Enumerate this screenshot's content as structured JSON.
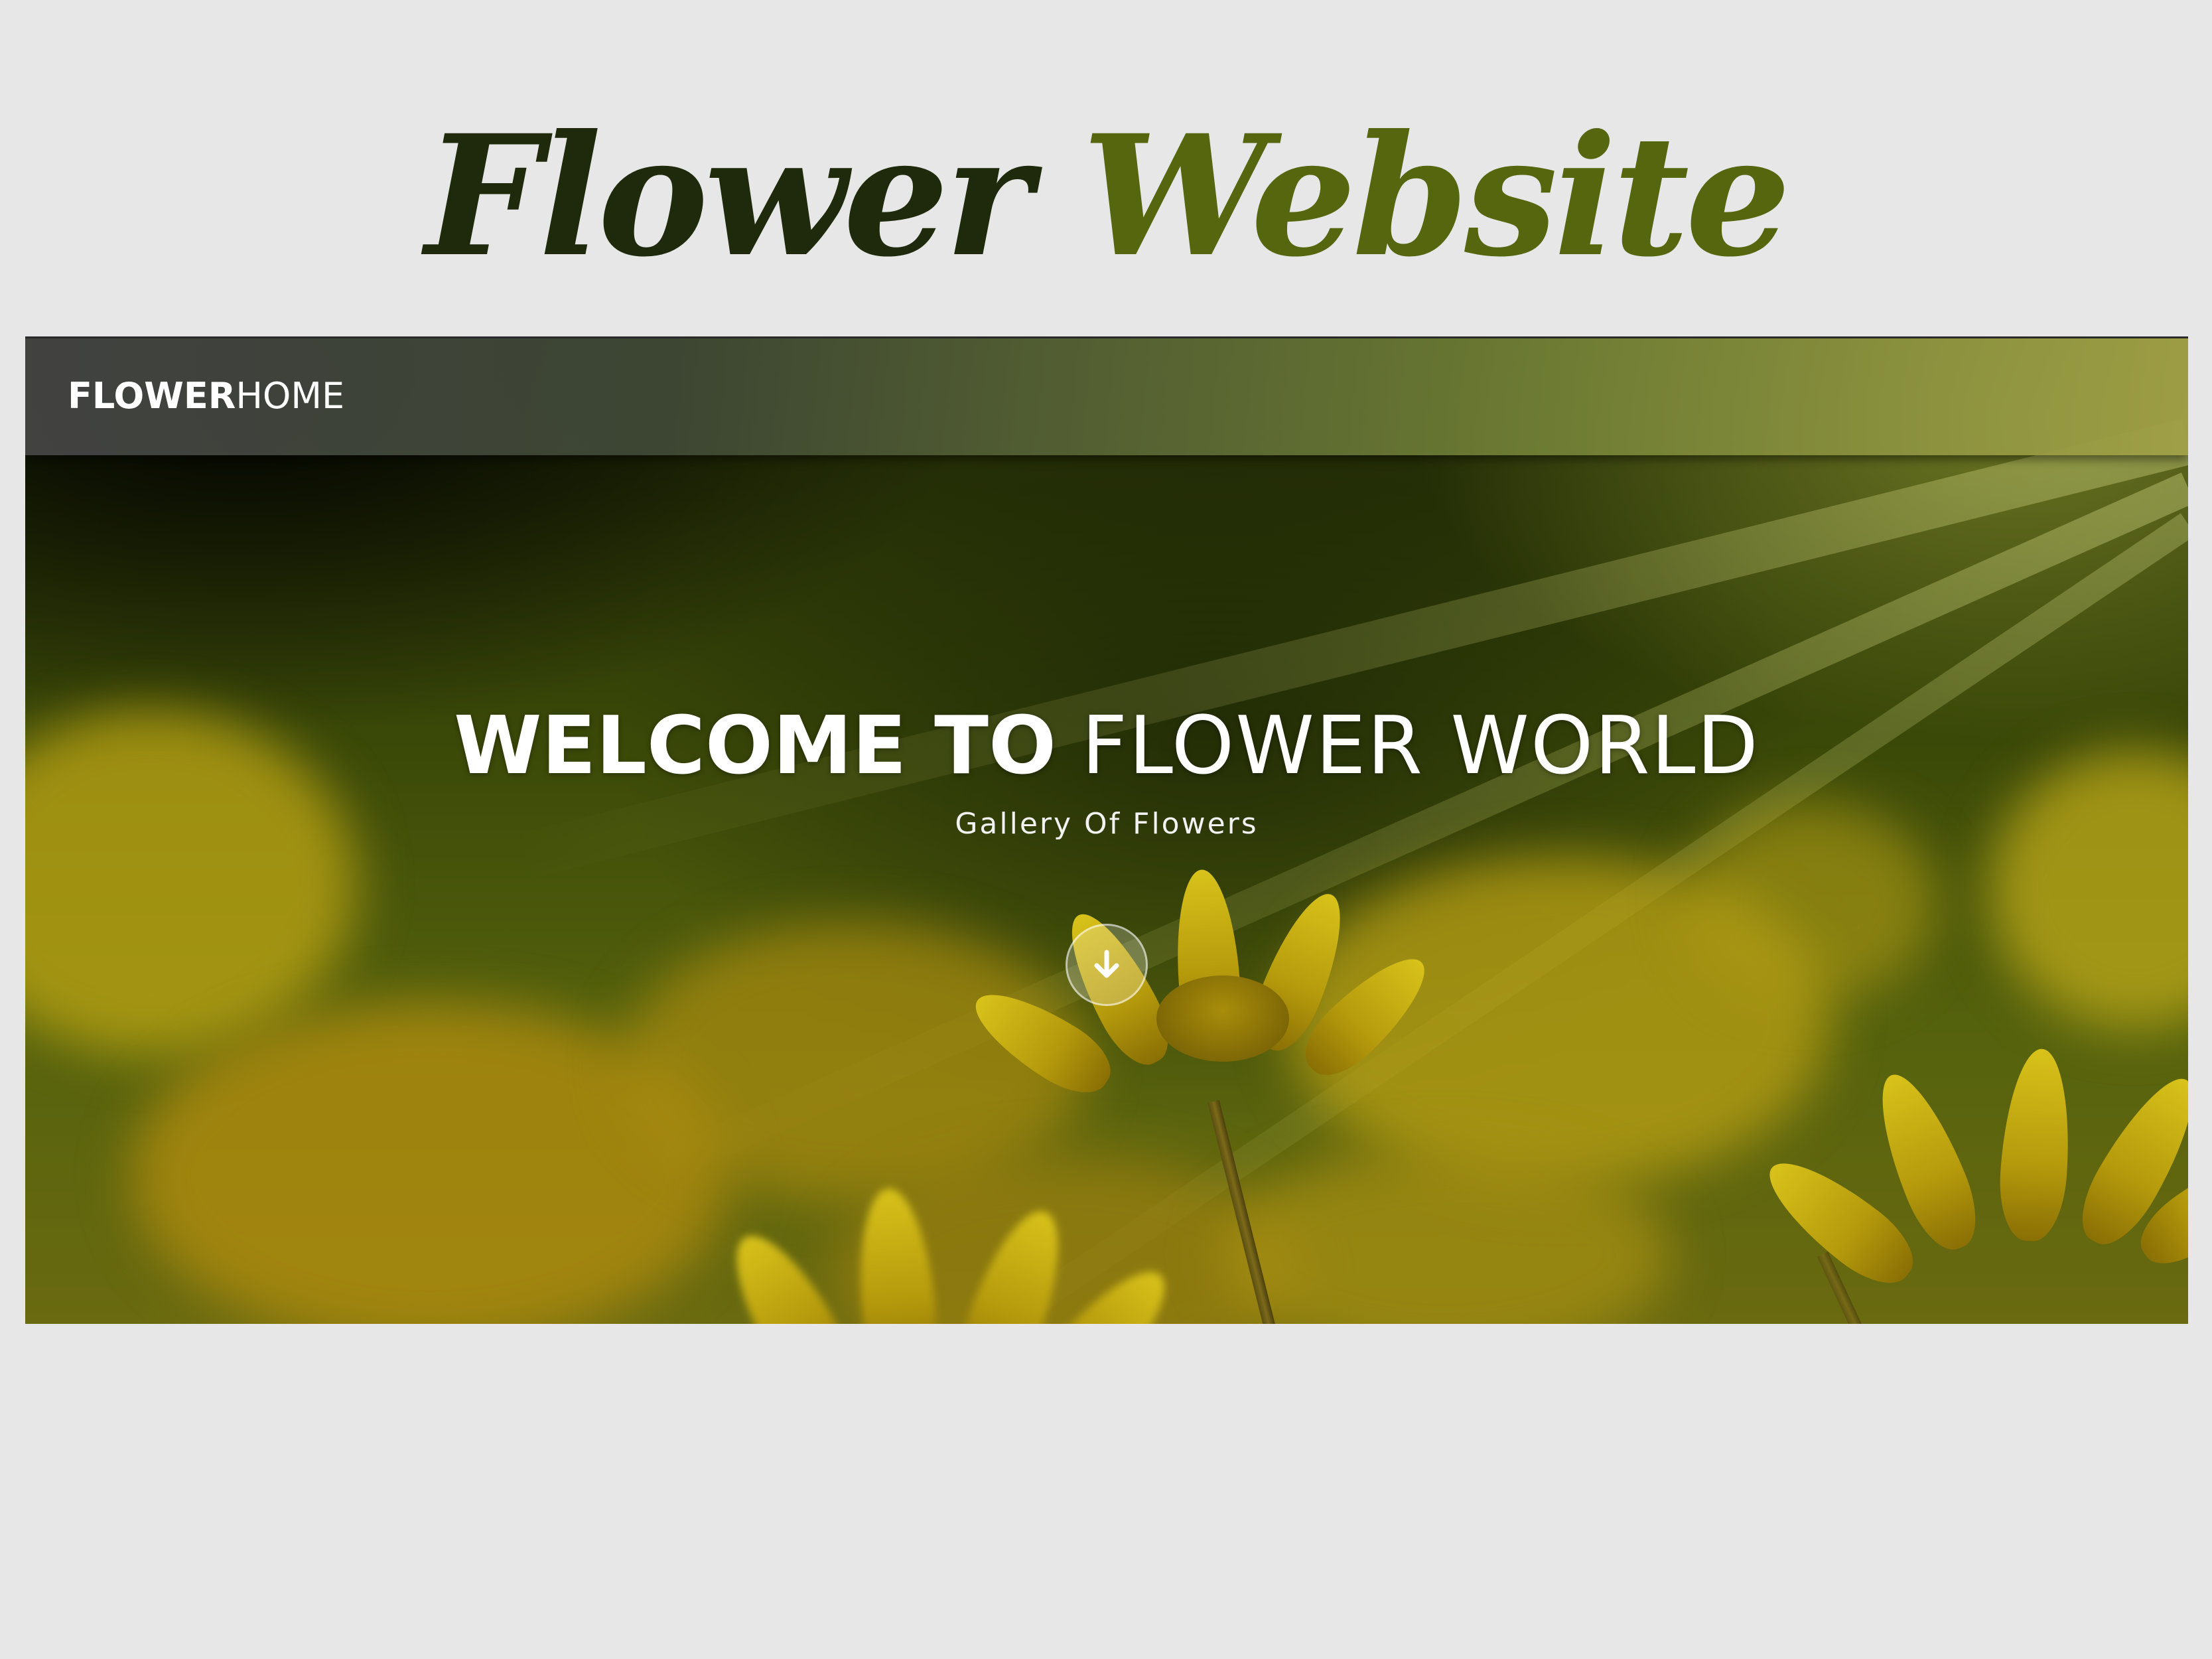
{
  "page_title": {
    "part1": "Flower",
    "part2": "Website"
  },
  "navbar": {
    "brand_bold": "FLOWER",
    "brand_light": "HOME"
  },
  "hero": {
    "heading_bold": "WELCOME TO",
    "heading_light": "FLOWER WORLD",
    "subheading": "Gallery Of Flowers",
    "scroll_icon": "arrow-down-icon"
  },
  "colors": {
    "page_background": "#e7e7e7",
    "title_dark": "#1e2a0b",
    "title_green": "#55660f",
    "hero_text": "#ffffff",
    "flower_yellow": "#c9ad10"
  }
}
